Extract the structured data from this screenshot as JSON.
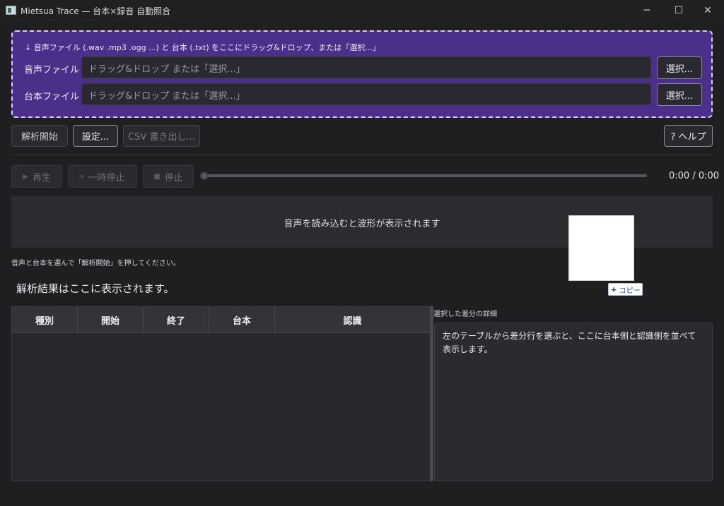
{
  "window": {
    "title": "Mietsua Trace — 台本×録音 自動照合",
    "minimize": "─",
    "maximize": "☐",
    "close": "✕"
  },
  "dropzone": {
    "hint": "↓ 音声ファイル (.wav .mp3 .ogg ...) と 台本 (.txt) をここにドラッグ&ドロップ、または「選択...」",
    "audio_label": "音声ファイル",
    "audio_placeholder": "ドラッグ&ドロップ または「選択...」",
    "script_label": "台本ファイル",
    "script_placeholder": "ドラッグ&ドロップ または「選択...」",
    "browse_label": "選択..."
  },
  "toolbar": {
    "analyze": "解析開始",
    "settings": "設定...",
    "export_csv": "CSV 書き出し...",
    "help": "? ヘルプ"
  },
  "player": {
    "play": "再生",
    "pause": "一時停止",
    "stop": "停止",
    "play_icon": "▶",
    "pause_icon": "⏸",
    "stop_icon": "■",
    "time": "0:00 / 0:00",
    "position": 0
  },
  "waveform": {
    "placeholder": "音声を読み込むと波形が表示されます"
  },
  "status": "音声と台本を選んで「解析開始」を押してください。",
  "result_summary": "解析結果はここに表示されます。",
  "copy_widget": {
    "label": "コピー",
    "icon": "+"
  },
  "table": {
    "columns": [
      "種別",
      "開始",
      "終了",
      "台本",
      "認識"
    ]
  },
  "detail": {
    "label": "選択した差分の詳細",
    "text": "左のテーブルから差分行を選ぶと、ここに台本側と認識側を並べて表示します。"
  },
  "colors": {
    "dropzone_bg": "#4b2f8a",
    "window_bg": "#1f1e21"
  }
}
